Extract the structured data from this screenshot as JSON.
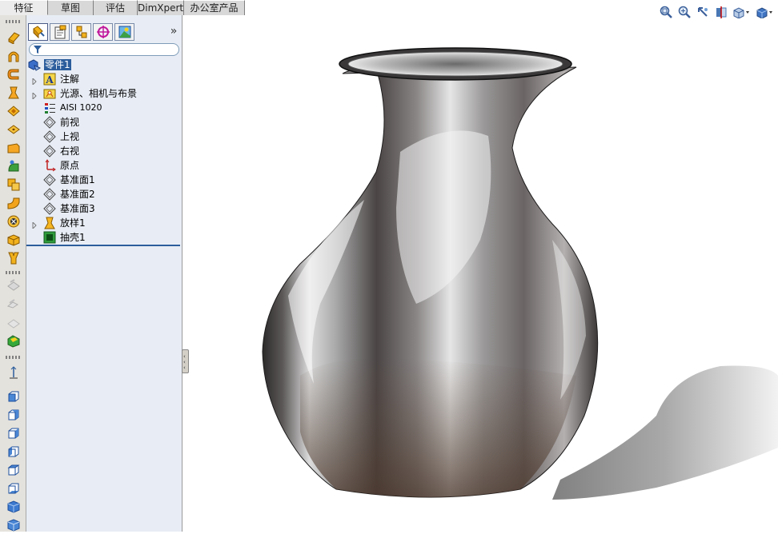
{
  "command_tabs": [
    {
      "label": "特征",
      "active": true
    },
    {
      "label": "草图",
      "active": false
    },
    {
      "label": "评估",
      "active": false
    },
    {
      "label": "DimXpert",
      "active": false
    },
    {
      "label": "办公室产品",
      "active": false
    }
  ],
  "view_toolbar": [
    "zoom-to-fit-icon",
    "zoom-to-area-icon",
    "previous-view-icon",
    "section-view-icon",
    "view-orientation-icon",
    "display-style-icon"
  ],
  "panel": {
    "tabs": [
      "feature-manager-icon",
      "property-manager-icon",
      "configuration-manager-icon",
      "dimxpert-manager-icon",
      "display-manager-icon"
    ],
    "expand_glyph": "»",
    "filter_placeholder": ""
  },
  "tree": {
    "root": "零件1",
    "items": [
      {
        "label": "注解",
        "icon": "annotations-icon",
        "expandable": true
      },
      {
        "label": "光源、相机与布景",
        "icon": "lights-cameras-scene-icon",
        "expandable": true
      },
      {
        "label": "AISI 1020",
        "icon": "material-icon",
        "expandable": false
      },
      {
        "label": "前视",
        "icon": "plane-icon",
        "expandable": false
      },
      {
        "label": "上视",
        "icon": "plane-icon",
        "expandable": false
      },
      {
        "label": "右视",
        "icon": "plane-icon",
        "expandable": false
      },
      {
        "label": "原点",
        "icon": "origin-icon",
        "expandable": false
      },
      {
        "label": "基准面1",
        "icon": "plane-icon",
        "expandable": false
      },
      {
        "label": "基准面2",
        "icon": "plane-icon",
        "expandable": false
      },
      {
        "label": "基准面3",
        "icon": "plane-icon",
        "expandable": false
      },
      {
        "label": "放样1",
        "icon": "loft-icon",
        "expandable": true
      },
      {
        "label": "抽壳1",
        "icon": "shell-icon",
        "expandable": false
      }
    ]
  },
  "colors": {
    "accent": "#2c5d9c",
    "panel_bg": "#e8edf5",
    "toolbar_bg": "#e4e2dc"
  }
}
